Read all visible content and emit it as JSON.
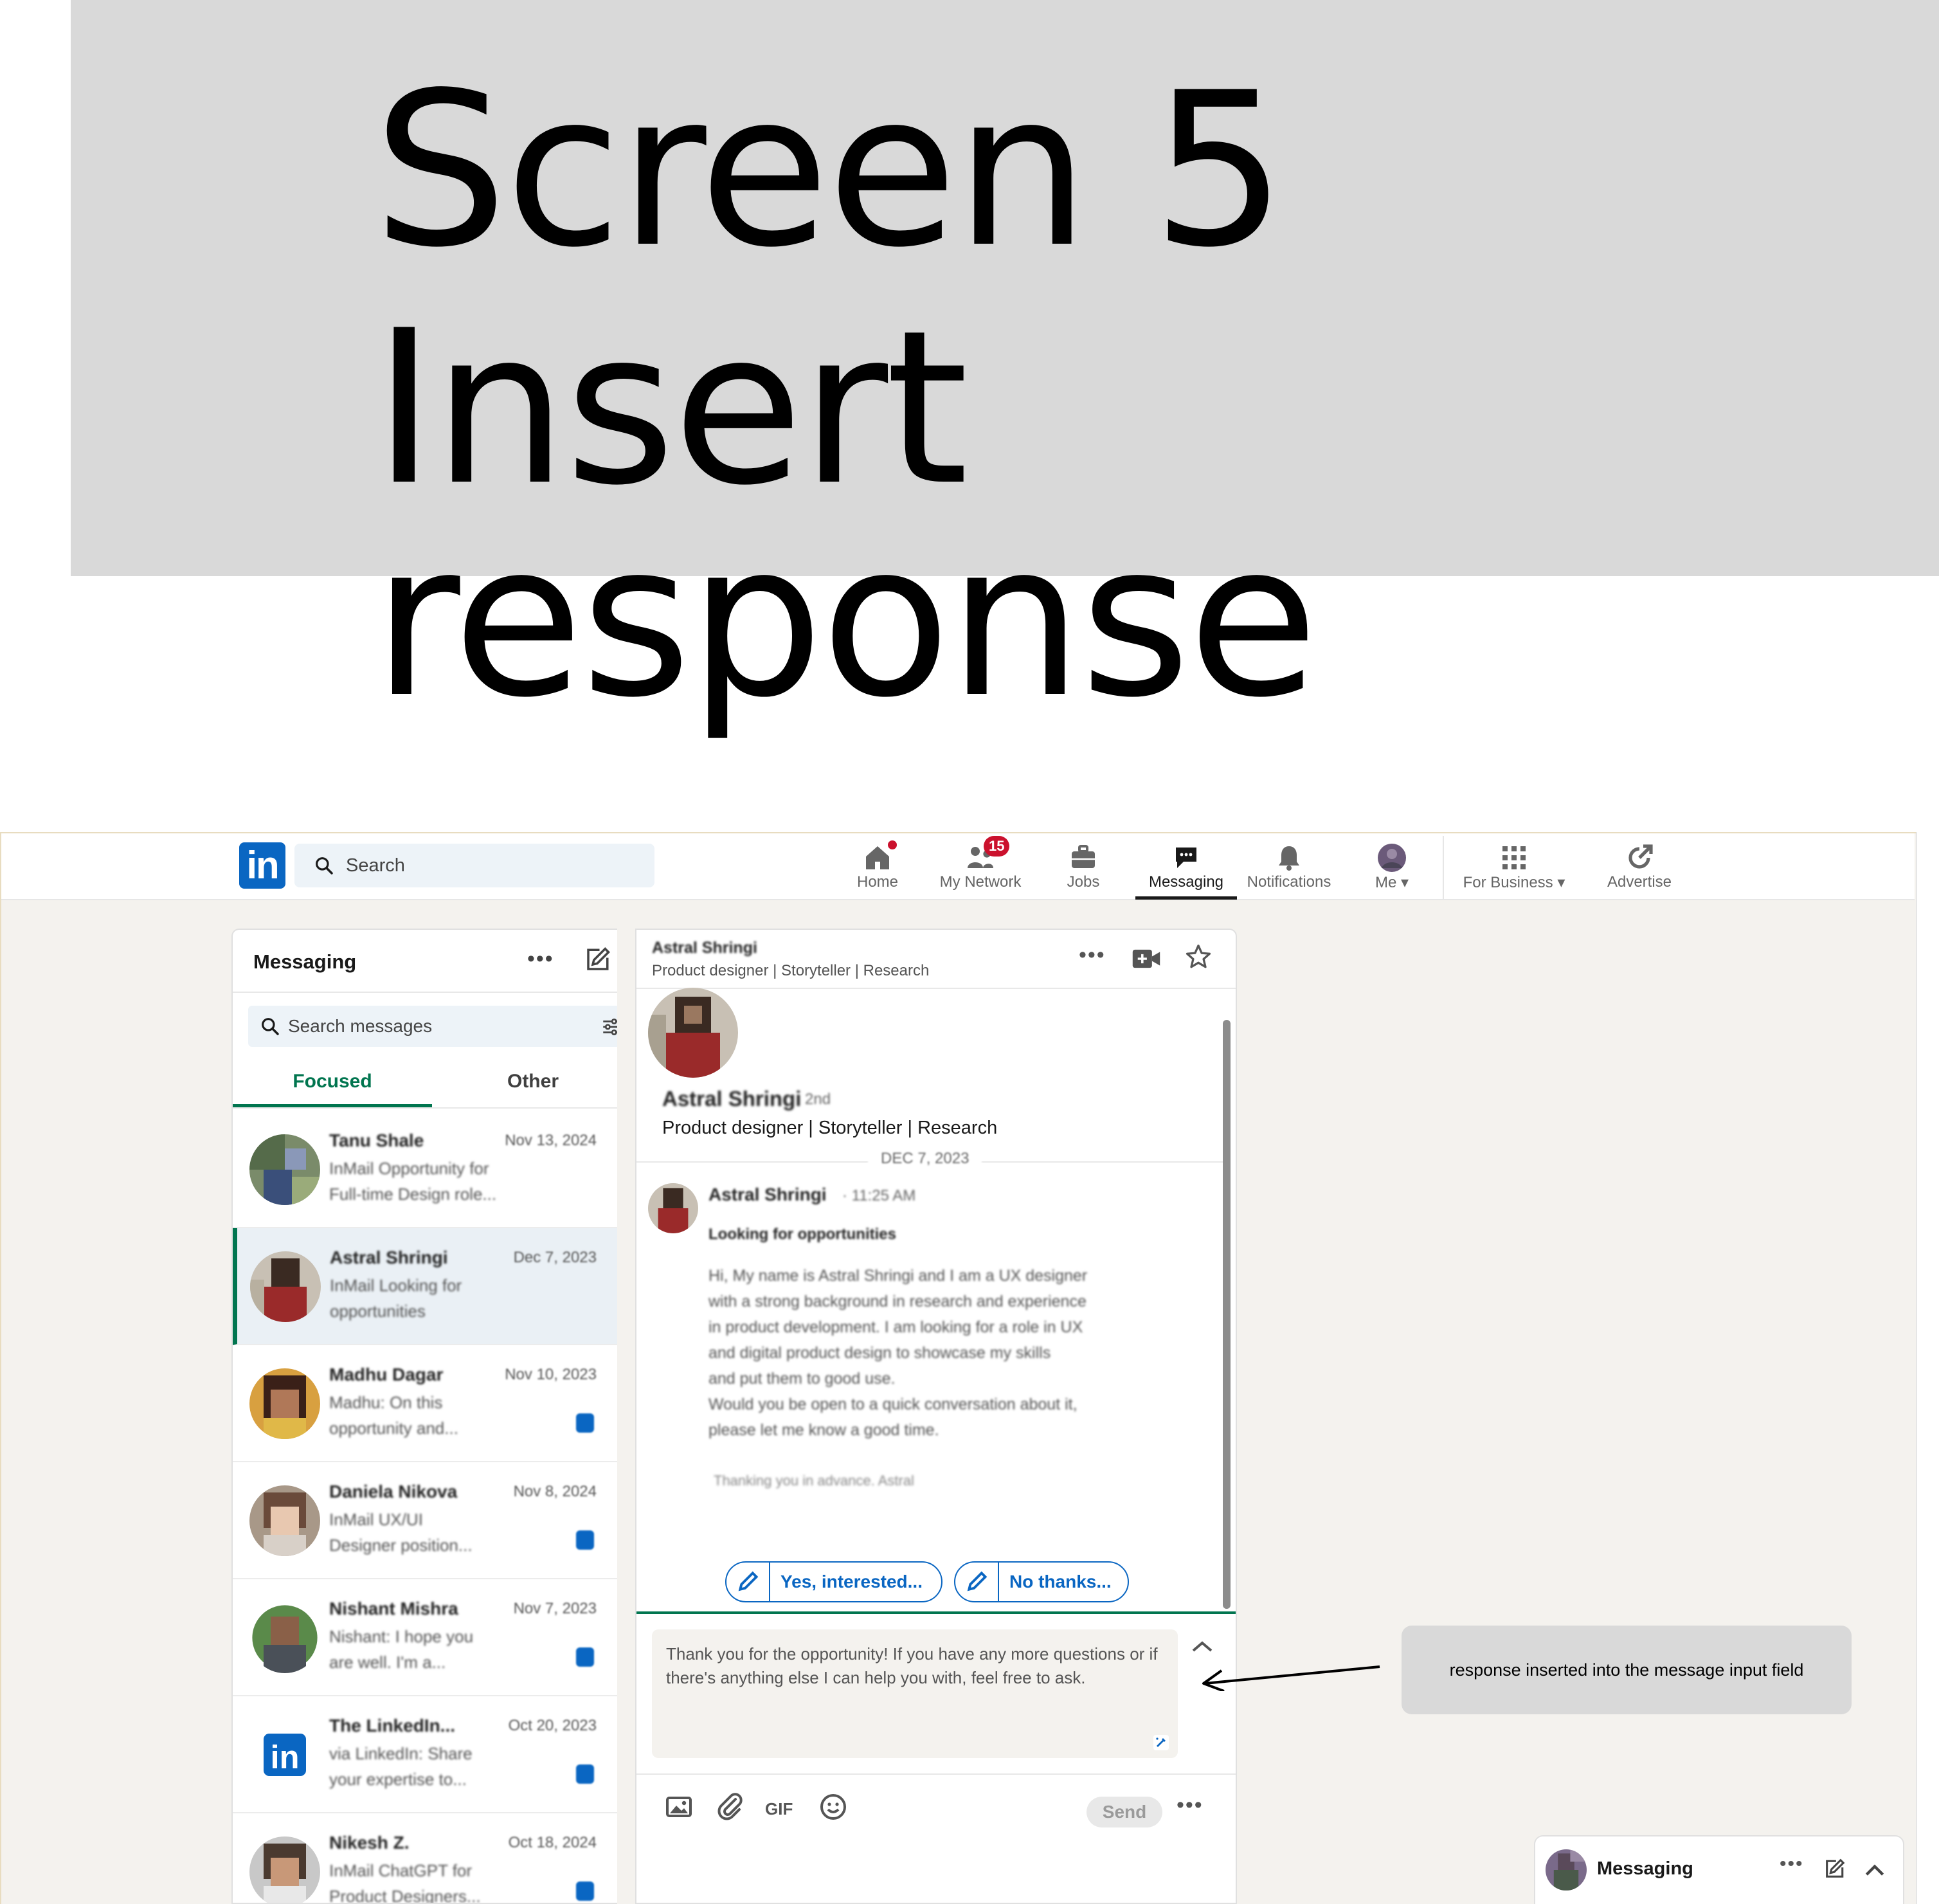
{
  "banner": {
    "line1": "Screen 5",
    "line2": "Insert response"
  },
  "nav": {
    "logo": "in",
    "search_placeholder": "Search",
    "items": [
      {
        "label": "Home",
        "icon": "home-icon"
      },
      {
        "label": "My Network",
        "icon": "network-icon",
        "badge": "15"
      },
      {
        "label": "Jobs",
        "icon": "jobs-icon"
      },
      {
        "label": "Messaging",
        "icon": "messaging-icon",
        "active": true
      },
      {
        "label": "Notifications",
        "icon": "bell-icon"
      },
      {
        "label": "Me",
        "icon": "avatar"
      },
      {
        "label": "For Business",
        "icon": "grid-icon"
      },
      {
        "label": "Advertise",
        "icon": "advertise-icon"
      }
    ]
  },
  "list": {
    "title": "Messaging",
    "more": "•••",
    "search_placeholder": "Search messages",
    "tabs": [
      "Focused",
      "Other"
    ],
    "conversations": [
      {
        "name": "Tanu Shale",
        "date": "Nov 13, 2024",
        "snippet1": "InMail  Opportunity for",
        "snippet2": "Full-time Design role...",
        "unread": false,
        "active": false
      },
      {
        "name": "Astral Shringi",
        "date": "Dec 7, 2023",
        "snippet1": "InMail  Looking for",
        "snippet2": "opportunities",
        "unread": false,
        "active": true
      },
      {
        "name": "Madhu Dagar",
        "date": "Nov 10, 2023",
        "snippet1": "Madhu: On this",
        "snippet2": "opportunity and...",
        "unread": true,
        "active": false
      },
      {
        "name": "Daniela Nikova",
        "date": "Nov 8, 2024",
        "snippet1": "InMail  UX/UI",
        "snippet2": "Designer position...",
        "unread": true,
        "active": false
      },
      {
        "name": "Nishant Mishra",
        "date": "Nov 7, 2023",
        "snippet1": "Nishant: I hope you",
        "snippet2": "are well. I'm a...",
        "unread": true,
        "active": false
      },
      {
        "name": "The LinkedIn...",
        "date": "Oct 20, 2023",
        "snippet1": "via LinkedIn: Share",
        "snippet2": "your expertise to...",
        "unread": true,
        "active": false
      },
      {
        "name": "Nikesh Z.",
        "date": "Oct 18, 2024",
        "snippet1": "InMail  ChatGPT for",
        "snippet2": "Product Designers...",
        "unread": true,
        "active": false
      }
    ]
  },
  "conversation": {
    "header_name": "Astral Shringi",
    "header_sub": "Product designer | Storyteller | Research",
    "more": "•••",
    "profile_name": "Astral Shringi",
    "profile_degree": "2nd",
    "profile_headline": "Product designer | Storyteller | Research",
    "date_divider": "DEC 7, 2023",
    "message": {
      "sender": "Astral Shringi",
      "time": "· 11:25 AM",
      "subject": "Looking for opportunities",
      "lines": [
        "Hi, My name is Astral Shringi and I am a UX designer",
        "with a strong background in research and experience",
        "in product development. I am looking for a role in UX",
        "and digital product design to showcase my skills",
        "and put them to good use.",
        "Would you be open to a quick conversation about it,",
        "please let me know a good time."
      ],
      "footer": "Thanking you in advance. Astral"
    },
    "suggestions": [
      "Yes, interested...",
      "No thanks..."
    ],
    "compose_text": "Thank you for the opportunity! If you have any more questions or if there's anything else I can help you with, feel free to ask.",
    "gif_label": "GIF",
    "send_label": "Send",
    "send_more": "•••"
  },
  "annotation": {
    "text": "response inserted into the message input field"
  },
  "tray": {
    "title": "Messaging",
    "more": "•••"
  },
  "colors": {
    "brand": "#0a66c2",
    "focus_green": "#01754f",
    "badge_red": "#cb112d",
    "banner_gray": "#d9d9d9"
  }
}
